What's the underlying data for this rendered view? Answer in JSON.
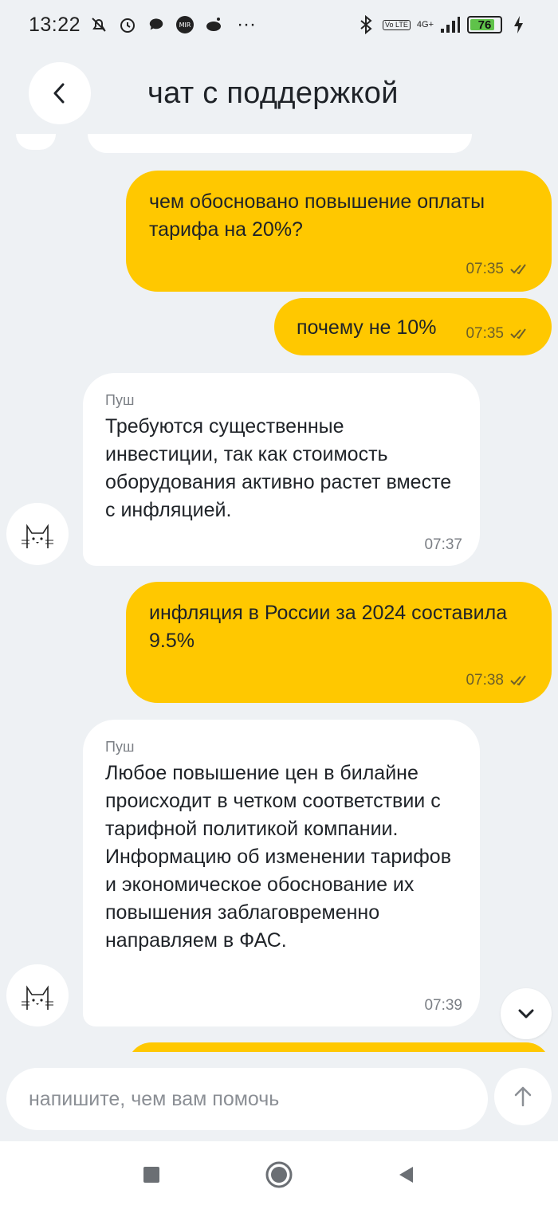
{
  "status_bar": {
    "time": "13:22",
    "network": "4G+",
    "volte": "Vo LTE",
    "battery": "76",
    "battery_level_percent": 76,
    "more": "···"
  },
  "header": {
    "title": "чат с поддержкой"
  },
  "messages": [
    {
      "direction": "outgoing",
      "text": "чем обосновано повышение оплаты тарифа на 20%?",
      "time": "07:35",
      "read": true
    },
    {
      "direction": "outgoing",
      "text": "почему не 10%",
      "time": "07:35",
      "read": true
    },
    {
      "direction": "incoming",
      "sender": "Пуш",
      "text": "Требуются существенные инвестиции, так как стоимость оборудования активно растет вместе с инфляцией.",
      "time": "07:37"
    },
    {
      "direction": "outgoing",
      "text": "инфляция в России за 2024 составила 9.5%",
      "time": "07:38",
      "read": true
    },
    {
      "direction": "incoming",
      "sender": "Пуш",
      "text": "Любое повышение цен в билайне происходит в четком соответствии с тарифной политикой компании. Информацию об изменении тарифов и экономическое обоснование их повышения заблаговременно направляем в ФАС.",
      "time": "07:39"
    }
  ],
  "composer": {
    "placeholder": "напишите, чем вам помочь"
  },
  "colors": {
    "outgoing_bubble": "#ffc800",
    "incoming_bubble": "#ffffff",
    "background": "#eef1f4"
  }
}
